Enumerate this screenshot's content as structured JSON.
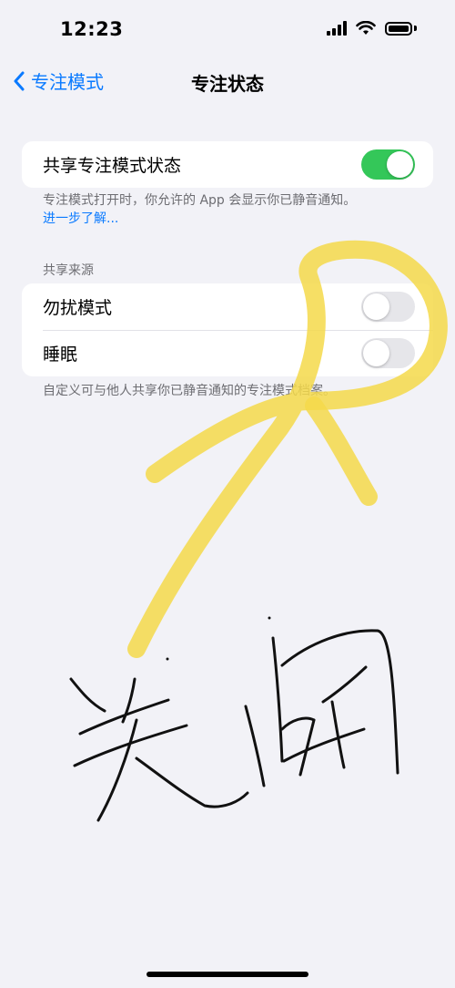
{
  "status_bar": {
    "time": "12:23"
  },
  "nav": {
    "back_label": "专注模式",
    "title": "专注状态"
  },
  "share_status": {
    "label": "共享专注模式状态",
    "on": true,
    "footer_text": "专注模式打开时，你允许的 App 会显示你已静音通知。",
    "footer_link": "进一步了解..."
  },
  "share_from": {
    "header": "共享来源",
    "items": [
      {
        "label": "勿扰模式",
        "on": false
      },
      {
        "label": "睡眠",
        "on": false
      }
    ],
    "footer_text": "自定义可与他人共享你已静音通知的专注模式档案。"
  },
  "annotation": {
    "handwritten_text": "关闭",
    "highlight_color": "#f5d94a"
  },
  "colors": {
    "accent": "#0a7aff",
    "toggle_on": "#34c759",
    "background": "#f2f2f7"
  }
}
